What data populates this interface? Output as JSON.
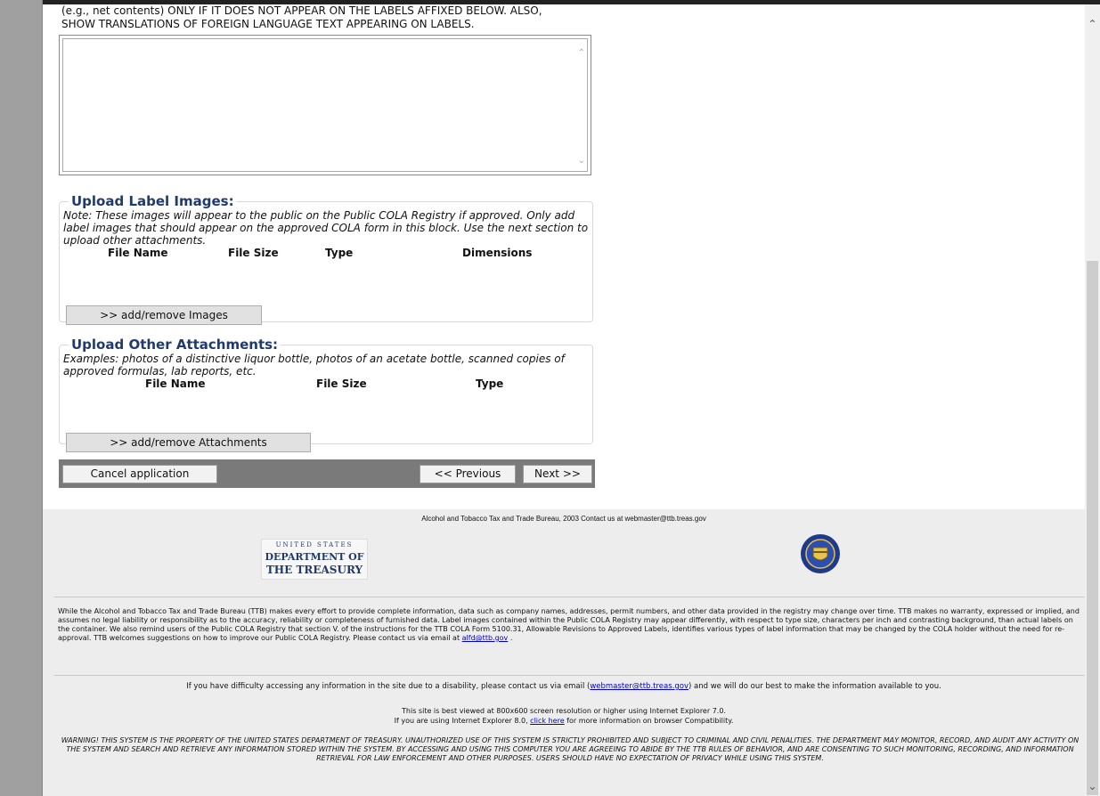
{
  "instructions": {
    "text_line1": "(e.g., net contents) ONLY IF IT DOES NOT APPEAR ON THE LABELS AFFIXED BELOW. ALSO,",
    "text_line2": "SHOW TRANSLATIONS OF FOREIGN LANGUAGE TEXT APPEARING ON LABELS."
  },
  "upload_label_images": {
    "title": "Upload Label Images:",
    "note": "Note: These images will appear to the public on the Public COLA Registry if approved. Only add label images that should appear on the approved COLA form in this block. Use the next section to upload other attachments.",
    "columns": [
      "File Name",
      "File Size",
      "Type",
      "Dimensions"
    ],
    "button": ">> add/remove Images"
  },
  "upload_other_attachments": {
    "title": "Upload Other Attachments:",
    "note": "Examples: photos of a distinctive liquor bottle, photos of an acetate bottle, scanned copies of approved formulas, lab reports, etc.",
    "columns": [
      "File Name",
      "File Size",
      "Type"
    ],
    "button": ">> add/remove Attachments"
  },
  "nav": {
    "cancel": "Cancel application",
    "previous": "<< Previous",
    "next": "Next >>"
  },
  "footer": {
    "contact": "Alcohol and Tobacco Tax and Trade Bureau, 2003  Contact us at webmaster@ttb.treas.gov",
    "logo_us": "UNITED STATES",
    "logo_dept": "DEPARTMENT OF",
    "logo_treasury": "THE TREASURY",
    "disclaimer": "While the Alcohol and Tobacco Tax and Trade Bureau (TTB) makes every effort to provide complete information, data such as company names, addresses, permit numbers, and other data provided in the registry may change over time. TTB makes no warranty, expressed or implied, and assumes no legal liability or responsibility as to the accuracy, reliability or completeness of furnished data. Label images contained within the Public COLA Registry may appear differently, with respect to type size, characters per inch and contrasting background, than actual labels on the container. We also remind users of the Public COLA Registry that section V. of the instructions for the TTB COLA Form 5100.31, Allowable Revisions to Approved Labels, identifies various types of label information that may be changed by the COLA holder without the need for re-approval. TTB welcomes suggestions on how to improve our Public COLA Registry. Please contact us via email at",
    "disclaimer_link": "alfd@ttb.gov",
    "disclaimer_end": " .",
    "access_pre": "If you have difficulty accessing any information in the site due to a disability, please contact us via email (",
    "access_link": "webmaster@ttb.treas.gov",
    "access_post": ") and we will do our best to make the information available to you.",
    "browser_line1": "This site is best viewed at 800x600 screen resolution or higher using Internet Explorer 7.0.",
    "browser_pre": "If you are using Internet Explorer 8.0, ",
    "browser_link": "click here",
    "browser_post": " for more information on browser Compatibility.",
    "warning": "WARNING! THIS SYSTEM IS THE PROPERTY OF THE UNITED STATES DEPARTMENT OF TREASURY. UNAUTHORIZED USE OF THIS SYSTEM IS STRICTLY PROHIBITED AND SUBJECT TO CRIMINAL AND CIVIL PENALITIES. THE DEPARTMENT MAY MONITOR, RECORD, AND AUDIT ANY ACTIVITY ON THE SYSTEM AND SEARCH AND RETRIEVE ANY INFORMATION STORED WITHIN THE SYSTEM. BY ACCESSING AND USING THIS COMPUTER YOU ARE AGREEING TO ABIDE BY THE TTB RULES OF BEHAVIOR, AND ARE CONSENTING TO SUCH MONITORING, RECORDING, AND INFORMATION RETRIEVAL FOR LAW ENFORCEMENT AND OTHER PURPOSES. USERS SHOULD HAVE NO EXPECTATION OF PRIVACY WHILE USING THIS SYSTEM."
  },
  "colors": {
    "legend_blue": "#1f3a6b",
    "nav_bar": "#7a7a7a",
    "footer_bg": "#ededed",
    "link": "#0000cc"
  }
}
